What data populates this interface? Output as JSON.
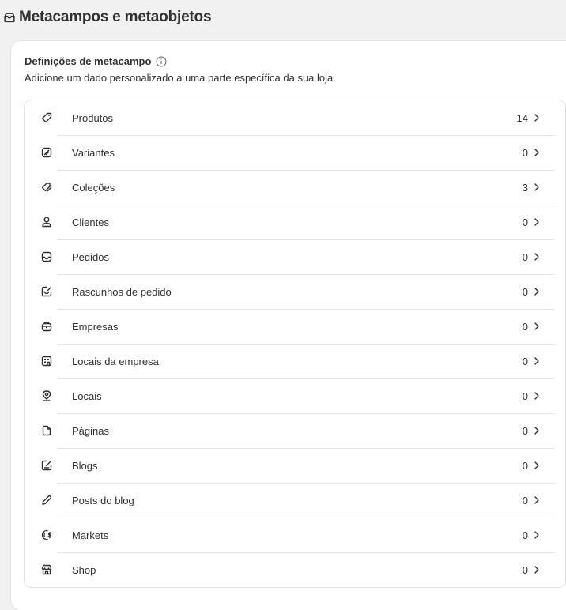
{
  "header": {
    "title": "Metacampos e metaobjetos",
    "icon": "archive-box-icon"
  },
  "card": {
    "title": "Definições de metacampo",
    "description": "Adicione um dado personalizado a uma parte específica da sua loja."
  },
  "items": [
    {
      "label": "Produtos",
      "count": "14",
      "icon": "tag-icon"
    },
    {
      "label": "Variantes",
      "count": "0",
      "icon": "variant-tag-icon"
    },
    {
      "label": "Coleções",
      "count": "3",
      "icon": "collection-tags-icon"
    },
    {
      "label": "Clientes",
      "count": "0",
      "icon": "person-icon"
    },
    {
      "label": "Pedidos",
      "count": "0",
      "icon": "inbox-icon"
    },
    {
      "label": "Rascunhos de pedido",
      "count": "0",
      "icon": "draft-order-icon"
    },
    {
      "label": "Empresas",
      "count": "0",
      "icon": "briefcase-icon"
    },
    {
      "label": "Locais da empresa",
      "count": "0",
      "icon": "building-icon"
    },
    {
      "label": "Locais",
      "count": "0",
      "icon": "location-pin-icon"
    },
    {
      "label": "Páginas",
      "count": "0",
      "icon": "page-icon"
    },
    {
      "label": "Blogs",
      "count": "0",
      "icon": "blog-icon"
    },
    {
      "label": "Posts do blog",
      "count": "0",
      "icon": "pencil-icon"
    },
    {
      "label": "Markets",
      "count": "0",
      "icon": "globe-currency-icon"
    },
    {
      "label": "Shop",
      "count": "0",
      "icon": "storefront-icon"
    }
  ]
}
